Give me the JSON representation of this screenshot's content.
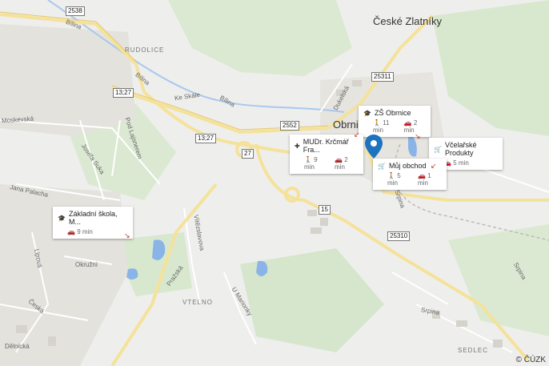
{
  "places": {
    "ceske_zlatniky": "České Zlatníky",
    "obrnice": "Obrnic",
    "rudolice": "RUDOLICE",
    "vtelno": "VTELNO",
    "sedlec": "SEDLEC"
  },
  "streets": {
    "bilina1": "Bílina",
    "bilina2": "Bílina",
    "bilina3": "Bílina",
    "ke_skale": "Ke Skále",
    "moskevska": "Moskevská",
    "pod_lajsnerem": "Pod Lajsnerem",
    "josefa_suka": "Josefa Suka",
    "jana_palacha": "Jana Palacha",
    "lipova": "Lipová",
    "okruzni": "Okružní",
    "ceska": "Česká",
    "delnicka": "Dělnická",
    "vitezslavova": "Vítězslavova",
    "prazska": "Pražská",
    "u_marionky": "U Marionky",
    "dukelska": "Dukelská",
    "srpina1": "Srpina",
    "srpina2": "Srpina",
    "srpina3": "Srpina"
  },
  "roads": {
    "r2538": "2538",
    "r13_27a": "13;27",
    "r13_27b": "13;27",
    "r2552": "2552",
    "r27": "27",
    "r15": "15",
    "r25311": "25311",
    "r25310": "25310"
  },
  "cards": {
    "zs_obrnice": {
      "name": "ZŠ Obrnice",
      "walk": "11 min",
      "car": "2 min"
    },
    "mudr": {
      "name": "MUDr. Krčmář Fra...",
      "walk": "9 min",
      "car": "2 min"
    },
    "vcelarske": {
      "name": "Včelařské Produkty",
      "car": "5 min"
    },
    "muj_obchod": {
      "name": "Můj obchod",
      "walk": "5 min",
      "car": "1 min"
    },
    "zakladni": {
      "name": "Základní škola, M...",
      "car": "9 min"
    }
  },
  "copyright": "© ČÚZK",
  "colors": {
    "pin": "#1e73be",
    "road": "#f5e29a",
    "water": "#8ab4e8",
    "green": "#d5e8c8"
  }
}
